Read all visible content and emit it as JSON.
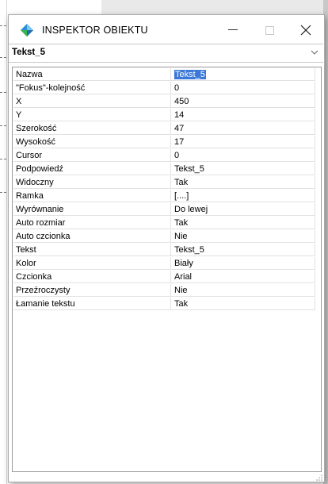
{
  "window": {
    "title": "INSPEKTOR OBIEKTU",
    "controls": {
      "minimize": "–",
      "maximize": "□",
      "close": "✕"
    }
  },
  "selector": {
    "value": "Tekst_5",
    "icon": "chevron-down-icon"
  },
  "properties": [
    {
      "name": "Nazwa",
      "value": "Tekst_5",
      "highlighted": true
    },
    {
      "name": "\"Fokus\"-kolejność",
      "value": "0"
    },
    {
      "name": "X",
      "value": "450"
    },
    {
      "name": "Y",
      "value": "14"
    },
    {
      "name": "Szerokość",
      "value": "47"
    },
    {
      "name": "Wysokość",
      "value": "17"
    },
    {
      "name": "Cursor",
      "value": "0"
    },
    {
      "name": "Podpowiedź",
      "value": "Tekst_5"
    },
    {
      "name": "Widoczny",
      "value": "Tak"
    },
    {
      "name": "Ramka",
      "value": "[....]"
    },
    {
      "name": "Wyrównanie",
      "value": "Do lewej"
    },
    {
      "name": "Auto rozmiar",
      "value": "Tak"
    },
    {
      "name": "Auto czcionka",
      "value": "Nie"
    },
    {
      "name": "Tekst",
      "value": "Tekst_5"
    },
    {
      "name": "Kolor",
      "value": "Biały"
    },
    {
      "name": "Czcionka",
      "value": "Arial"
    },
    {
      "name": "Przeźroczysty",
      "value": "Nie"
    },
    {
      "name": "Łamanie tekstu",
      "value": "Tak"
    }
  ],
  "colors": {
    "selection": "#3b78d7",
    "app_icon_blue": "#2a8fd8",
    "app_icon_green": "#3cb34a"
  }
}
